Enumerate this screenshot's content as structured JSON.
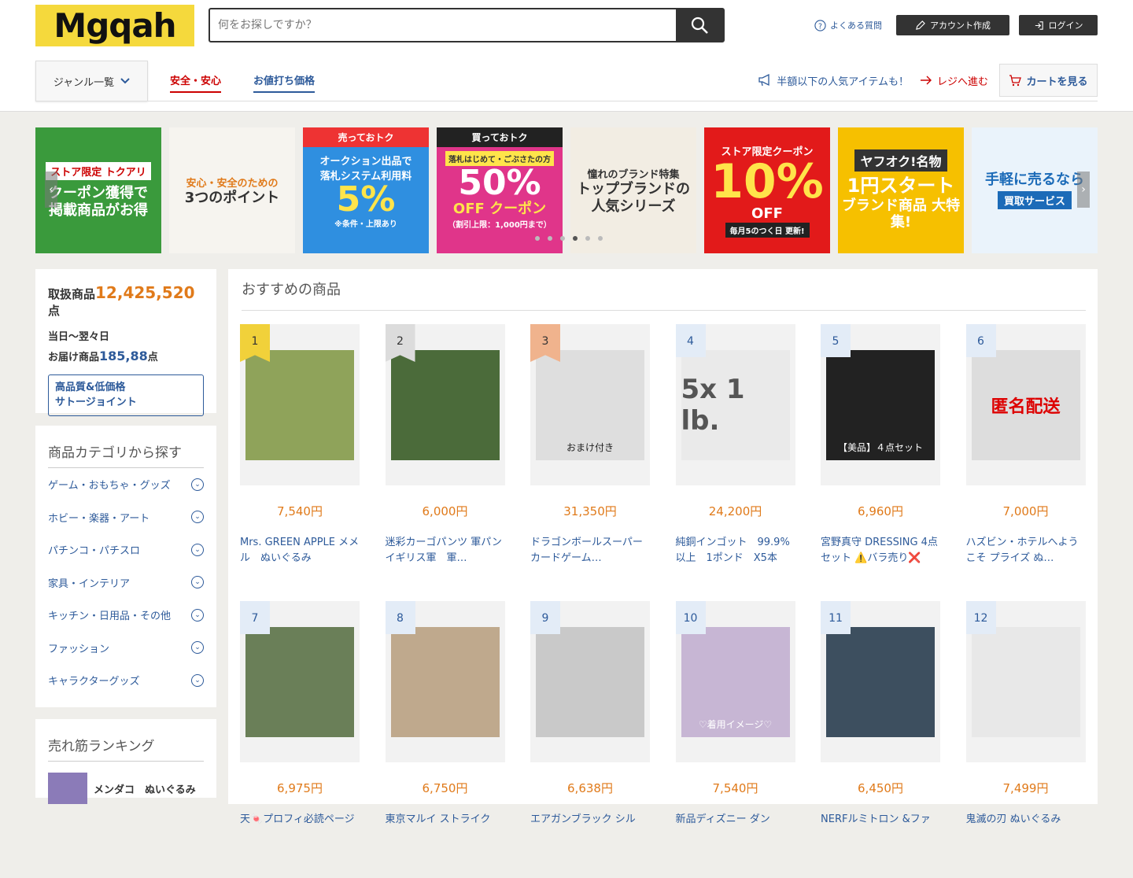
{
  "header": {
    "logo": "Mgqah",
    "search_placeholder": "何をお探しですか？",
    "faq": "よくある質問",
    "create_account": "アカウント作成",
    "login": "ログイン",
    "genre_button": "ジャンル一覧",
    "tabs": [
      "安全・安心",
      "お値打ち価格"
    ],
    "promo": "半額以下の人気アイテムも！",
    "checkout": "レジへ進む",
    "cart": "カートを見る"
  },
  "banners": [
    {
      "tag": "ストア限定 トクアリ",
      "line1": "クーポン獲得で",
      "line2": "掲載商品がお得"
    },
    {
      "line1": "安心・安全のための",
      "line2": "3つのポイント"
    },
    {
      "head": "売っておトク",
      "line1": "オークション出品で",
      "line2": "落札システム利用料",
      "big": "5%",
      "small": "※条件・上限あり"
    },
    {
      "head": "買っておトク",
      "line1": "落札はじめて・ごぶさたの方",
      "big": "50%",
      "line2": "OFF クーポン",
      "small": "（割引上限：1,000円まで）"
    },
    {
      "line1": "憧れのブランド特集",
      "line2": "トップブランドの 人気シリーズ"
    },
    {
      "line1": "ストア限定クーポン",
      "big": "10%",
      "line2": "OFF",
      "small": "毎月5のつく日 更新!"
    },
    {
      "head": "ヤフオク!名物",
      "line1": "1円スタート",
      "line2": "ブランド商品 大特集!"
    },
    {
      "line1": "手軽に売るなら",
      "head": "買取サービス"
    }
  ],
  "sidebar": {
    "stats": {
      "label1": "取扱商品",
      "count": "12,425,520",
      "unit": "点",
      "label2": "当日〜翌々日",
      "label3": "お届け商品",
      "count2": "185,88",
      "unit2": "点",
      "button_line1": "高品質&低価格",
      "button_line2": "サトージョイント"
    },
    "categories_title": "商品カテゴリから探す",
    "categories": [
      "ゲーム・おもちゃ・グッズ",
      "ホビー・楽器・アート",
      "パチンコ・パチスロ",
      "家具・インテリア",
      "キッチン・日用品・その他",
      "ファッション",
      "キャラクターグッズ"
    ],
    "ranking_title": "売れ筋ランキング",
    "ranking_first": "メンダコ　ぬいぐるみ"
  },
  "main": {
    "title": "おすすめの商品",
    "products": [
      {
        "rank": "1",
        "price": "7,540円",
        "name": "Mrs. GREEN APPLE メメル　ぬいぐるみ",
        "caption": ""
      },
      {
        "rank": "2",
        "price": "6,000円",
        "name": "迷彩カーゴパンツ 軍パン　イギリス軍　軍…",
        "caption": ""
      },
      {
        "rank": "3",
        "price": "31,350円",
        "name": "ドラゴンボールスーパーカードゲーム…",
        "caption": "おまけ付き"
      },
      {
        "rank": "4",
        "price": "24,200円",
        "name": "純銅インゴット　99.9%以上　1ポンド　X5本",
        "caption": "5x 1 lb."
      },
      {
        "rank": "5",
        "price": "6,960円",
        "name": "宮野真守 DRESSING 4点セット ⚠️バラ売り❌",
        "caption": "【美品】４点セット"
      },
      {
        "rank": "6",
        "price": "7,000円",
        "name": "ハズビン・ホテルへようこそ プライズ ぬ…",
        "caption": "匿名配送"
      },
      {
        "rank": "7",
        "price": "6,975円",
        "name": "天🍬プロフィ必読ページ",
        "caption": ""
      },
      {
        "rank": "8",
        "price": "6,750円",
        "name": "東京マルイ ストライク",
        "caption": ""
      },
      {
        "rank": "9",
        "price": "6,638円",
        "name": "エアガンブラック シル",
        "caption": ""
      },
      {
        "rank": "10",
        "price": "7,540円",
        "name": "新品ディズニー ダン",
        "caption": "♡着用イメージ♡"
      },
      {
        "rank": "11",
        "price": "6,450円",
        "name": "NERFルミトロン &ファ",
        "caption": ""
      },
      {
        "rank": "12",
        "price": "7,499円",
        "name": "鬼滅の刃 ぬいぐるみ",
        "caption": ""
      }
    ]
  }
}
